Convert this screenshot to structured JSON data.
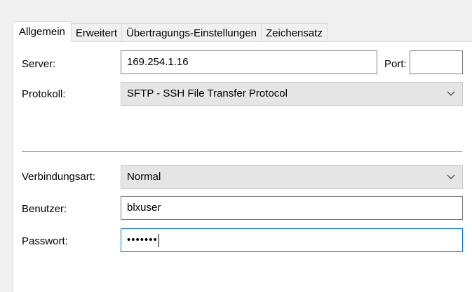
{
  "tabs": [
    {
      "label": "Allgemein",
      "active": true
    },
    {
      "label": "Erweitert",
      "active": false
    },
    {
      "label": "Übertragungs-Einstellungen",
      "active": false
    },
    {
      "label": "Zeichensatz",
      "active": false
    }
  ],
  "form": {
    "server_label": "Server:",
    "server_value": "169.254.1.16",
    "port_label": "Port:",
    "port_value": "",
    "protocol_label": "Protokoll:",
    "protocol_value": "SFTP - SSH File Transfer Protocol",
    "connection_label": "Verbindungsart:",
    "connection_value": "Normal",
    "user_label": "Benutzer:",
    "user_value": "blxuser",
    "password_label": "Passwort:",
    "password_value": "•••••••"
  },
  "colors": {
    "focus_border": "#0078d7",
    "select_background": "#e5e5e5"
  }
}
